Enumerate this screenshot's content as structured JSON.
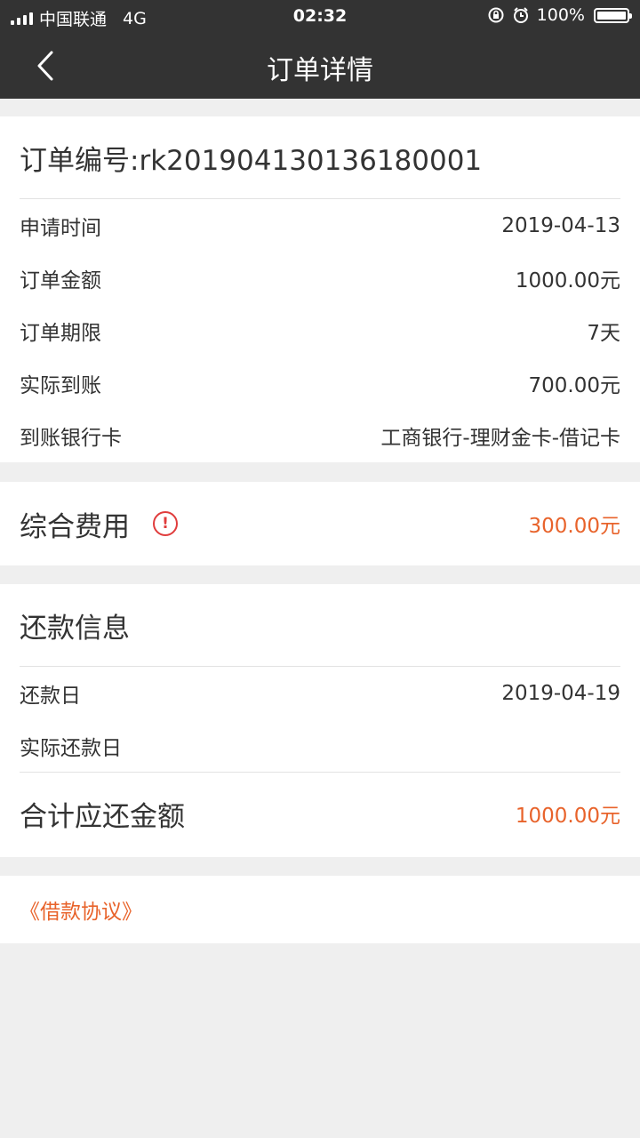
{
  "status_bar": {
    "carrier": "中国联通",
    "network": "4G",
    "time": "02:32",
    "battery": "100%"
  },
  "nav": {
    "title": "订单详情",
    "back_icon": "chevron-left-icon"
  },
  "order": {
    "number_label": "订单编号:rk201904130136180001",
    "fields": [
      {
        "label": "申请时间",
        "value": "2019-04-13"
      },
      {
        "label": "订单金额",
        "value": "1000.00元"
      },
      {
        "label": "订单期限",
        "value": "7天"
      },
      {
        "label": "实际到账",
        "value": "700.00元"
      },
      {
        "label": "到账银行卡",
        "value": "工商银行-理财金卡-借记卡"
      }
    ]
  },
  "fee": {
    "label": "综合费用",
    "icon": "exclamation-circle-icon",
    "value": "300.00元"
  },
  "repayment": {
    "title": "还款信息",
    "fields": [
      {
        "label": "还款日",
        "value": "2019-04-19"
      },
      {
        "label": "实际还款日",
        "value": ""
      }
    ],
    "total_label": "合计应还金额",
    "total_value": "1000.00元"
  },
  "agreement": {
    "link_text": "《借款协议》"
  },
  "colors": {
    "accent": "#e8632b",
    "alert": "#e03c3c",
    "header_bg": "#333333",
    "page_bg": "#efefef"
  }
}
